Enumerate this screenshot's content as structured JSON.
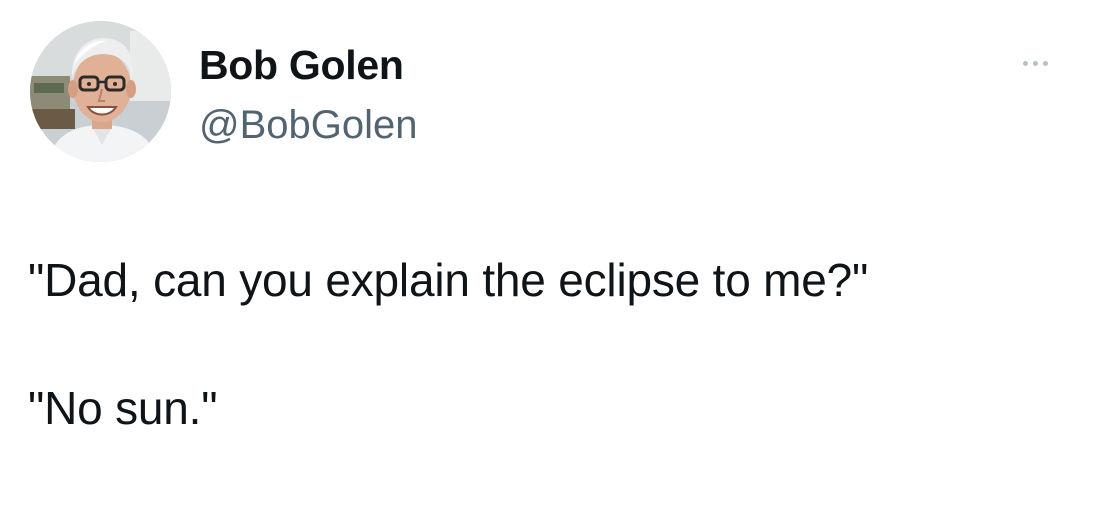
{
  "author": {
    "display_name": "Bob Golen",
    "handle": "@BobGolen",
    "avatar_icon": "profile-photo"
  },
  "tweet": {
    "line1": "\"Dad, can you explain the eclipse to me?\"",
    "line2": "\"No sun.\""
  },
  "more_icon": "ellipsis-icon",
  "colors": {
    "text": "#0f1419",
    "handle": "#536471",
    "more_dots": "#b9c0c6",
    "background": "#ffffff"
  }
}
